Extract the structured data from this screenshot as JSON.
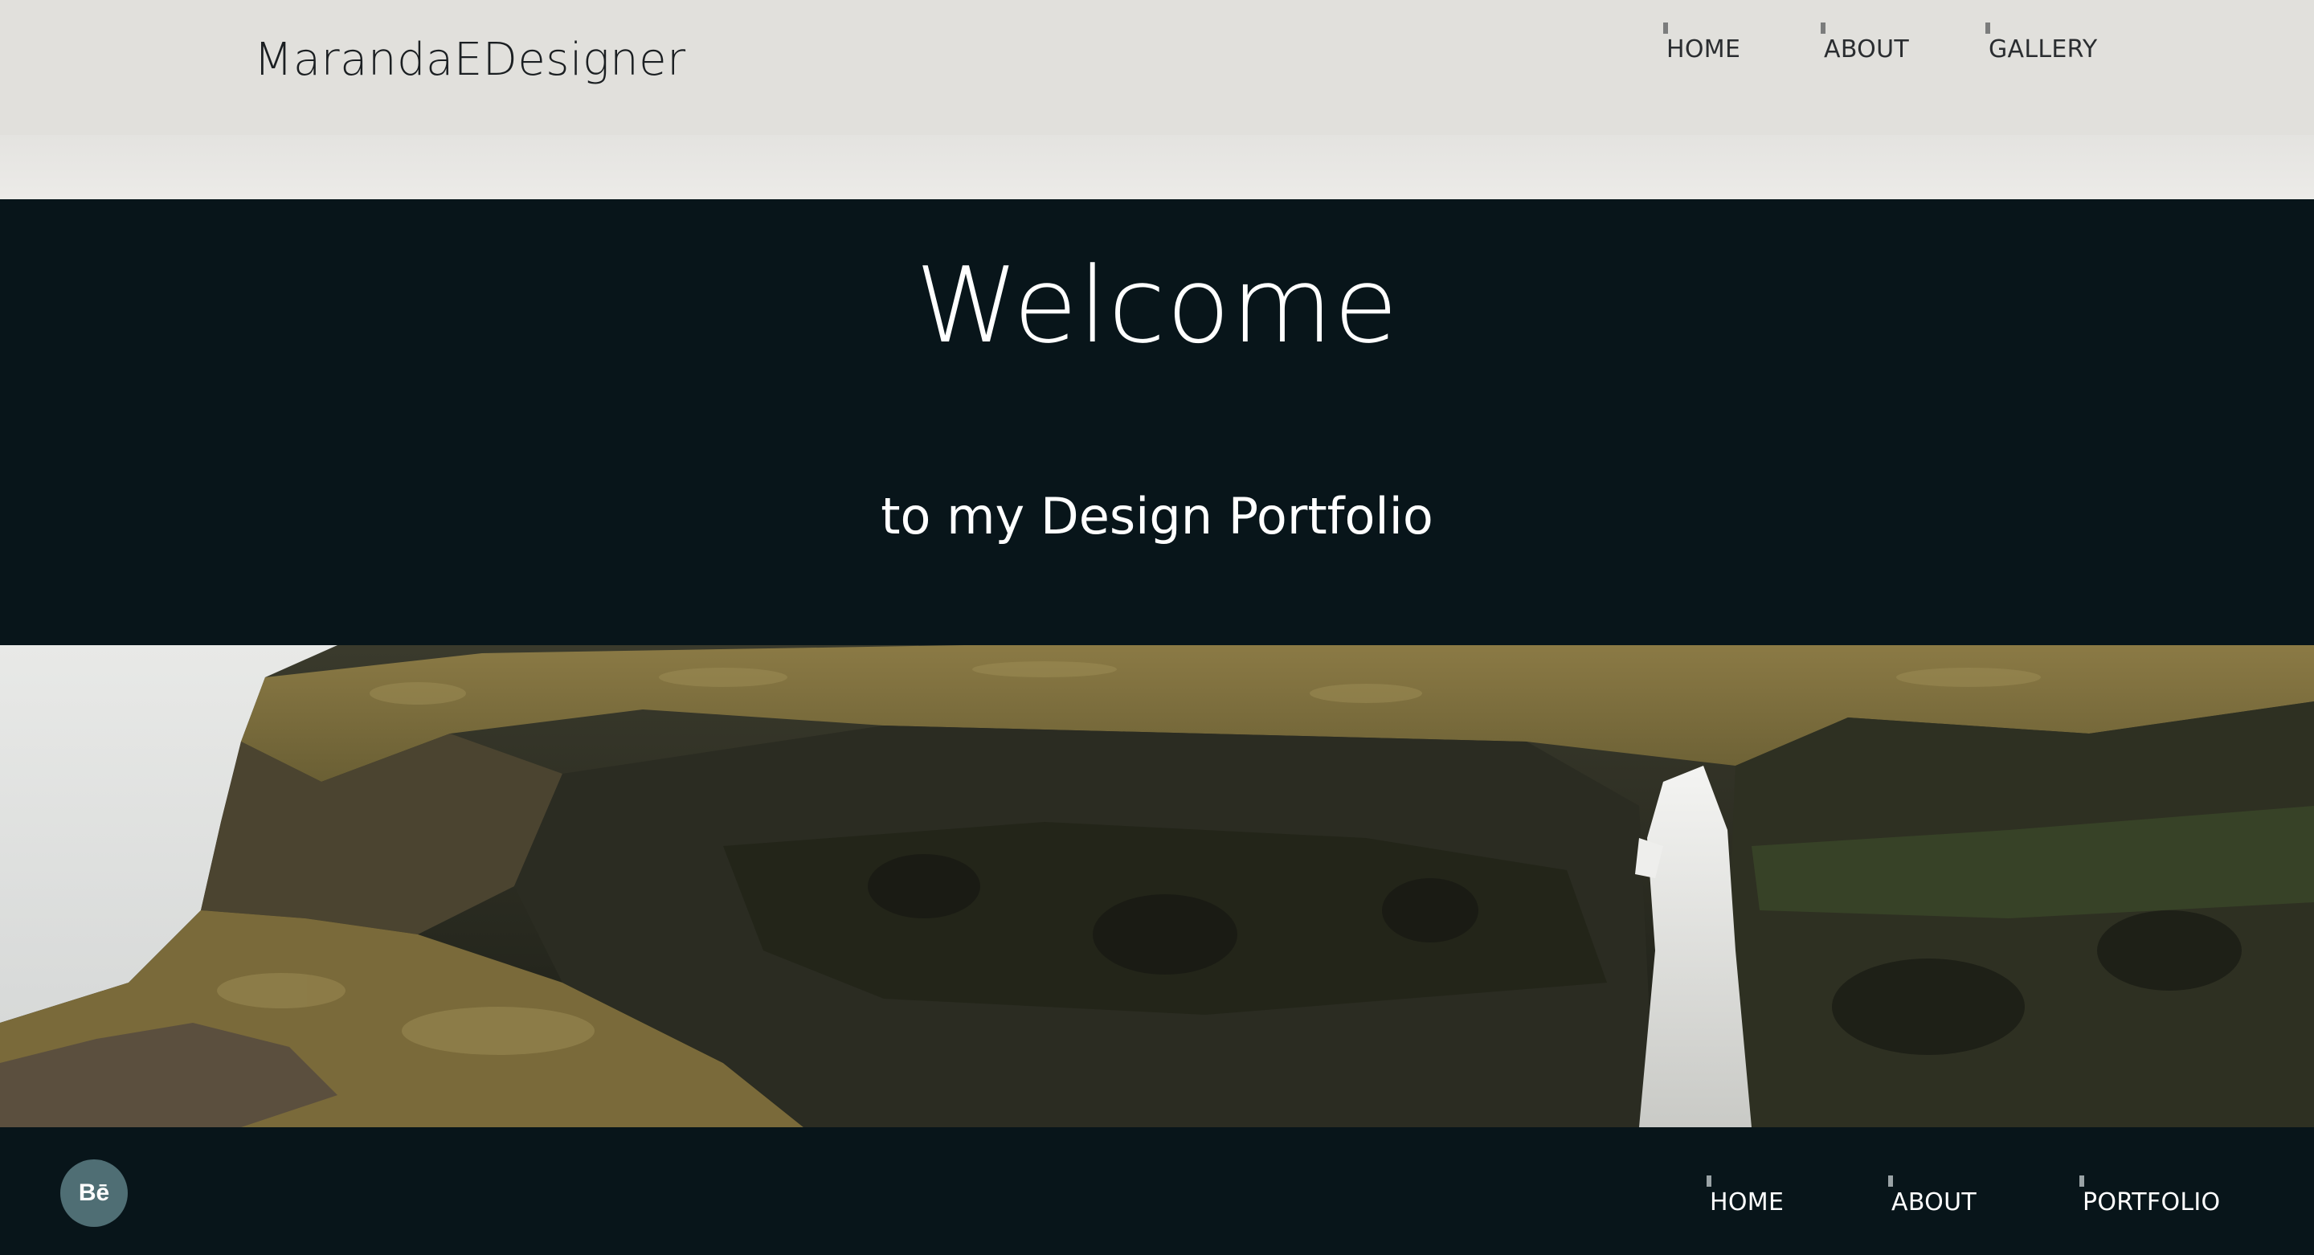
{
  "header": {
    "logo": "MarandaEDesigner",
    "nav": [
      "HOME",
      "ABOUT",
      "GALLERY"
    ]
  },
  "hero": {
    "title": "Welcome",
    "subtitle": "to my Design Portfolio"
  },
  "footer": {
    "social_label": "Bē",
    "social_icon": "behance-icon",
    "nav": [
      "HOME",
      "ABOUT",
      "PORTFOLIO"
    ]
  },
  "colors": {
    "header_bg": "#e1e0dc",
    "dark_bg": "#08151a",
    "social_bg": "#4f6e74"
  }
}
